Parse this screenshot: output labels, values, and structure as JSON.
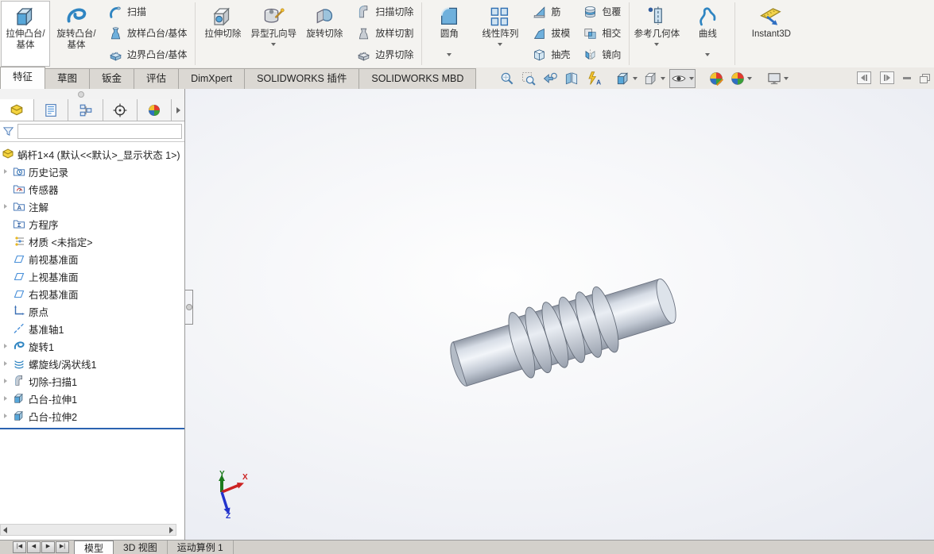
{
  "ribbon": {
    "buttons": [
      {
        "label": "拉伸凸台/基体",
        "icon": "extruded-boss-base-icon",
        "active": true
      },
      {
        "label": "旋转凸台/基体",
        "icon": "revolved-boss-base-icon"
      },
      {
        "label": "扫描",
        "icon": "swept-boss-icon"
      },
      {
        "label": "放样凸台/基体",
        "icon": "lofted-boss-base-icon"
      },
      {
        "label": "边界凸台/基体",
        "icon": "boundary-boss-base-icon"
      },
      {
        "label": "拉伸切除",
        "icon": "extruded-cut-icon"
      },
      {
        "label": "异型孔向导",
        "icon": "hole-wizard-icon",
        "dropdown": true
      },
      {
        "label": "旋转切除",
        "icon": "revolved-cut-icon"
      },
      {
        "label": "扫描切除",
        "icon": "swept-cut-icon"
      },
      {
        "label": "放样切割",
        "icon": "lofted-cut-icon"
      },
      {
        "label": "边界切除",
        "icon": "boundary-cut-icon"
      },
      {
        "label": "圆角",
        "icon": "fillet-icon",
        "dropdown": true
      },
      {
        "label": "线性阵列",
        "icon": "linear-pattern-icon",
        "dropdown": true
      },
      {
        "label": "筋",
        "icon": "rib-icon"
      },
      {
        "label": "拔模",
        "icon": "draft-icon"
      },
      {
        "label": "抽壳",
        "icon": "shell-icon"
      },
      {
        "label": "包覆",
        "icon": "wrap-icon"
      },
      {
        "label": "相交",
        "icon": "intersect-icon"
      },
      {
        "label": "镜向",
        "icon": "mirror-icon"
      },
      {
        "label": "参考几何体",
        "icon": "reference-geometry-icon",
        "dropdown": true
      },
      {
        "label": "曲线",
        "icon": "curves-icon",
        "dropdown": true
      },
      {
        "label": "Instant3D",
        "icon": "instant3d-icon"
      }
    ]
  },
  "tabs": [
    {
      "label": "特征",
      "active": true
    },
    {
      "label": "草图"
    },
    {
      "label": "钣金"
    },
    {
      "label": "评估"
    },
    {
      "label": "DimXpert"
    },
    {
      "label": "SOLIDWORKS 插件"
    },
    {
      "label": "SOLIDWORKS MBD"
    }
  ],
  "view_toolbar": {
    "icons": [
      "zoom-to-fit-icon",
      "zoom-to-area-icon",
      "previous-view-icon",
      "section-view-icon",
      "annotation-views-icon",
      "view-orientation-icon",
      "display-style-icon",
      "hide-show-items-icon",
      "edit-appearance-icon",
      "apply-scene-icon",
      "view-settings-icon"
    ],
    "pressed": "hide-show-items"
  },
  "window_buttons": [
    "collapse-left",
    "collapse-right",
    "minimize",
    "restore"
  ],
  "panel_tabs": [
    "featuremanager-design-tree",
    "propertymanager",
    "configurationmanager",
    "dimxpertmanager",
    "displaymanager"
  ],
  "feature_tree": {
    "root": "蜗杆1×4 (默认<<默认>_显示状态 1>)",
    "items": [
      {
        "label": "历史记录",
        "icon": "history-folder-icon",
        "expandable": true
      },
      {
        "label": "传感器",
        "icon": "sensors-folder-icon",
        "expandable": false
      },
      {
        "label": "注解",
        "icon": "annotations-folder-icon",
        "expandable": true
      },
      {
        "label": "方程序",
        "icon": "equations-folder-icon",
        "expandable": false
      },
      {
        "label": "材质 <未指定>",
        "icon": "material-icon",
        "expandable": false
      },
      {
        "label": "前视基准面",
        "icon": "plane-icon",
        "expandable": false
      },
      {
        "label": "上视基准面",
        "icon": "plane-icon",
        "expandable": false
      },
      {
        "label": "右视基准面",
        "icon": "plane-icon",
        "expandable": false
      },
      {
        "label": "原点",
        "icon": "origin-icon",
        "expandable": false
      },
      {
        "label": "基准轴1",
        "icon": "axis-icon",
        "expandable": false
      },
      {
        "label": "旋转1",
        "icon": "revolve-feature-icon",
        "expandable": true
      },
      {
        "label": "螺旋线/涡状线1",
        "icon": "helix-icon",
        "expandable": true
      },
      {
        "label": "切除-扫描1",
        "icon": "swept-cut-icon",
        "expandable": true
      },
      {
        "label": "凸台-拉伸1",
        "icon": "boss-extrude-icon",
        "expandable": true
      },
      {
        "label": "凸台-拉伸2",
        "icon": "boss-extrude-icon",
        "expandable": true
      }
    ]
  },
  "bottom": {
    "nav": [
      "|◀",
      "◀",
      "▶",
      "▶|"
    ],
    "tabs": [
      {
        "label": "模型",
        "active": true
      },
      {
        "label": "3D 视图"
      },
      {
        "label": "运动算例 1"
      }
    ]
  },
  "viewport": {
    "model": "worm-gear",
    "triad": {
      "x": "X",
      "y": "Y",
      "z": "Z"
    }
  },
  "glyphs": {
    "annotation_a": "A",
    "sigma": "Σ"
  },
  "colors": {
    "accent_blue": "#2f85c2",
    "rollback_bar": "#2b62b0",
    "triad_x": "#cc2222",
    "triad_y": "#1d7a1d",
    "triad_z": "#2233cc",
    "model_metal": "#c9d0da",
    "ribbon_bg": "#f4f3f0",
    "active_tab_bg": "#fdfdfd"
  }
}
